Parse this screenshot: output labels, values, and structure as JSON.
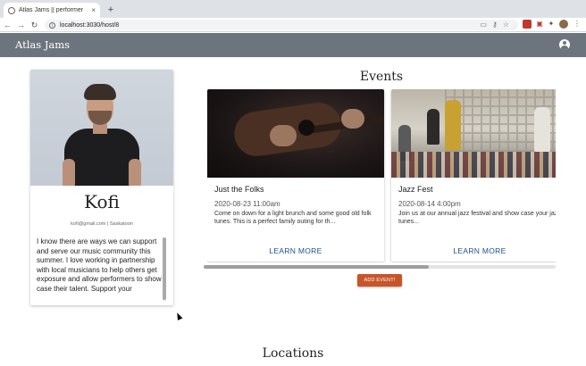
{
  "browser": {
    "tab_title": "Atlas Jams || performer",
    "tab_close": "×",
    "new_tab": "+",
    "url": "localhost:3030/host/8",
    "nav": {
      "back": "←",
      "forward": "→",
      "reload": "↻"
    },
    "icons": [
      "info-icon",
      "key-icon",
      "star-icon",
      "extension-icon",
      "profile-icon"
    ]
  },
  "app": {
    "brand": "Atlas Jams",
    "header_color": "#6c757d"
  },
  "profile": {
    "name": "Kofi",
    "meta": "kofi@gmail.com | Saskatoon",
    "bio": "I know there are ways we can support and serve our music community this summer. I love working in partnership with local musicians to help others get exposure and allow performers to show case their talent. Support your"
  },
  "events": {
    "title": "Events",
    "cards": [
      {
        "title": "Just the Folks",
        "datetime": "2020-08-23 11:00am",
        "description": "Come on down for a light brunch and some good old folk tunes. This is a perfect family outing for th...",
        "action": "LEARN MORE"
      },
      {
        "title": "Jazz Fest",
        "datetime": "2020-08-14 4:00pm",
        "description": "Join us at our annual jazz festival and show case your jazzy tunes...",
        "action": "LEARN MORE"
      }
    ],
    "add_button": "ADD EVENT!",
    "accent": "#c8552a",
    "scroll_position": 0.64
  },
  "locations": {
    "title": "Locations"
  }
}
